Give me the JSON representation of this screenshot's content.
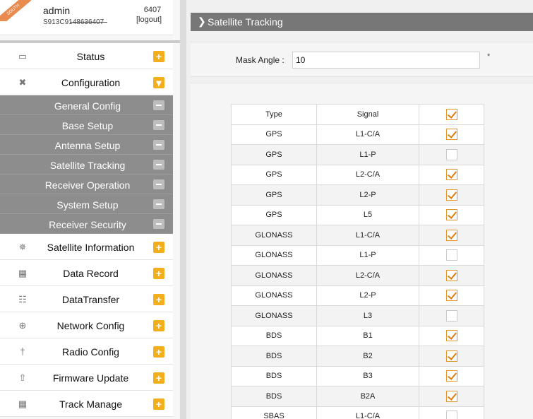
{
  "user": {
    "ribbon": "SOUTH",
    "name": "admin",
    "serial": "S913C9148636407",
    "id": "6407",
    "logout": "[logout]"
  },
  "nav": [
    {
      "key": "status",
      "icon": "monitor-icon",
      "label": "Status",
      "expanded": false
    },
    {
      "key": "configuration",
      "icon": "tools-icon",
      "label": "Configuration",
      "expanded": true,
      "children": [
        "General Config",
        "Base Setup",
        "Antenna Setup",
        "Satellite Tracking",
        "Receiver Operation",
        "System Setup",
        "Receiver Security"
      ]
    },
    {
      "key": "satellite-information",
      "icon": "satellite-icon",
      "label": "Satellite Information",
      "expanded": false
    },
    {
      "key": "data-record",
      "icon": "calendar-icon",
      "label": "Data Record",
      "expanded": false
    },
    {
      "key": "datatransfer",
      "icon": "network-icon",
      "label": "DataTransfer",
      "expanded": false
    },
    {
      "key": "network-config",
      "icon": "globe-icon",
      "label": "Network Config",
      "expanded": false
    },
    {
      "key": "radio-config",
      "icon": "antenna-icon",
      "label": "Radio Config",
      "expanded": false
    },
    {
      "key": "firmware-update",
      "icon": "upload-icon",
      "label": "Firmware Update",
      "expanded": false
    },
    {
      "key": "track-manage",
      "icon": "calendar-icon",
      "label": "Track Manage",
      "expanded": false
    }
  ],
  "page": {
    "title": "Satellite Tracking",
    "mask_label": "Mask Angle :",
    "mask_value": "10",
    "mask_note": "*"
  },
  "table": {
    "headers": [
      "Type",
      "Signal"
    ],
    "header_checked": true,
    "rows": [
      {
        "type": "GPS",
        "signal": "L1-C/A",
        "checked": true
      },
      {
        "type": "GPS",
        "signal": "L1-P",
        "checked": false
      },
      {
        "type": "GPS",
        "signal": "L2-C/A",
        "checked": true
      },
      {
        "type": "GPS",
        "signal": "L2-P",
        "checked": true
      },
      {
        "type": "GPS",
        "signal": "L5",
        "checked": true
      },
      {
        "type": "GLONASS",
        "signal": "L1-C/A",
        "checked": true
      },
      {
        "type": "GLONASS",
        "signal": "L1-P",
        "checked": false
      },
      {
        "type": "GLONASS",
        "signal": "L2-C/A",
        "checked": true
      },
      {
        "type": "GLONASS",
        "signal": "L2-P",
        "checked": true
      },
      {
        "type": "GLONASS",
        "signal": "L3",
        "checked": false
      },
      {
        "type": "BDS",
        "signal": "B1",
        "checked": true
      },
      {
        "type": "BDS",
        "signal": "B2",
        "checked": true
      },
      {
        "type": "BDS",
        "signal": "B3",
        "checked": true
      },
      {
        "type": "BDS",
        "signal": "B2A",
        "checked": true
      },
      {
        "type": "SBAS",
        "signal": "L1-C/A",
        "checked": false
      }
    ]
  },
  "colors": {
    "accent_orange": "#f2ae1d",
    "submenu_gray": "#8d8d8d",
    "title_bar": "#777777"
  }
}
